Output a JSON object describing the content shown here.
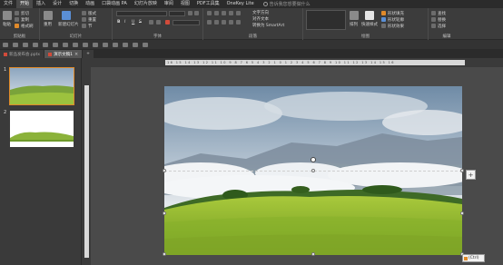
{
  "menu": {
    "items": [
      "文件",
      "开始",
      "插入",
      "设计",
      "切换",
      "动画",
      "口袋动画 PA",
      "幻灯片放映",
      "审阅",
      "视图",
      "PDF工具集",
      "OneKey Lite"
    ],
    "active_index": 1,
    "search_placeholder": "告诉我您想要做什么"
  },
  "ribbon": {
    "clipboard": {
      "cut": "剪切",
      "copy": "复制",
      "format_painter": "格式刷",
      "paste": "粘贴",
      "label": "剪贴板"
    },
    "slides": {
      "reuse": "重用",
      "new_slide": "新建幻灯片",
      "layout": "版式",
      "reset": "重置",
      "section": "节",
      "label": "幻灯片"
    },
    "font": {
      "bold": "B",
      "italic": "I",
      "underline": "U",
      "strike": "S",
      "label": "字体"
    },
    "paragraph": {
      "text_direction": "文字方向",
      "align_text": "对齐文本",
      "smartart": "转换为 SmartArt",
      "label": "段落"
    },
    "drawing": {
      "arrange": "排列",
      "quick_styles": "快速样式",
      "shape_fill": "形状填充",
      "shape_outline": "形状轮廓",
      "shape_effects": "形状效果",
      "label": "绘图"
    },
    "editing": {
      "find": "查找",
      "replace": "替换",
      "select": "选择",
      "label": "编辑"
    }
  },
  "tabs": [
    {
      "label": "新品发布会.pptx",
      "active": false
    },
    {
      "label": "演示文稿1",
      "active": true
    }
  ],
  "slides": [
    {
      "number": "1",
      "selected": true
    },
    {
      "number": "2",
      "selected": false
    }
  ],
  "ruler": {
    "marks": "16 15 14 13 12 11 10 9 8 7 6 5 4 3 2 1 0 1 2 3 4 5 6 7 8 9 10 11 12 13 14 15 16"
  },
  "side_button": {
    "icon": "plus-icon",
    "label": "+"
  },
  "paste_options": {
    "label": "(Ctrl)"
  },
  "colors": {
    "accent": "#e08a2a",
    "background": "#3a3a3a"
  }
}
